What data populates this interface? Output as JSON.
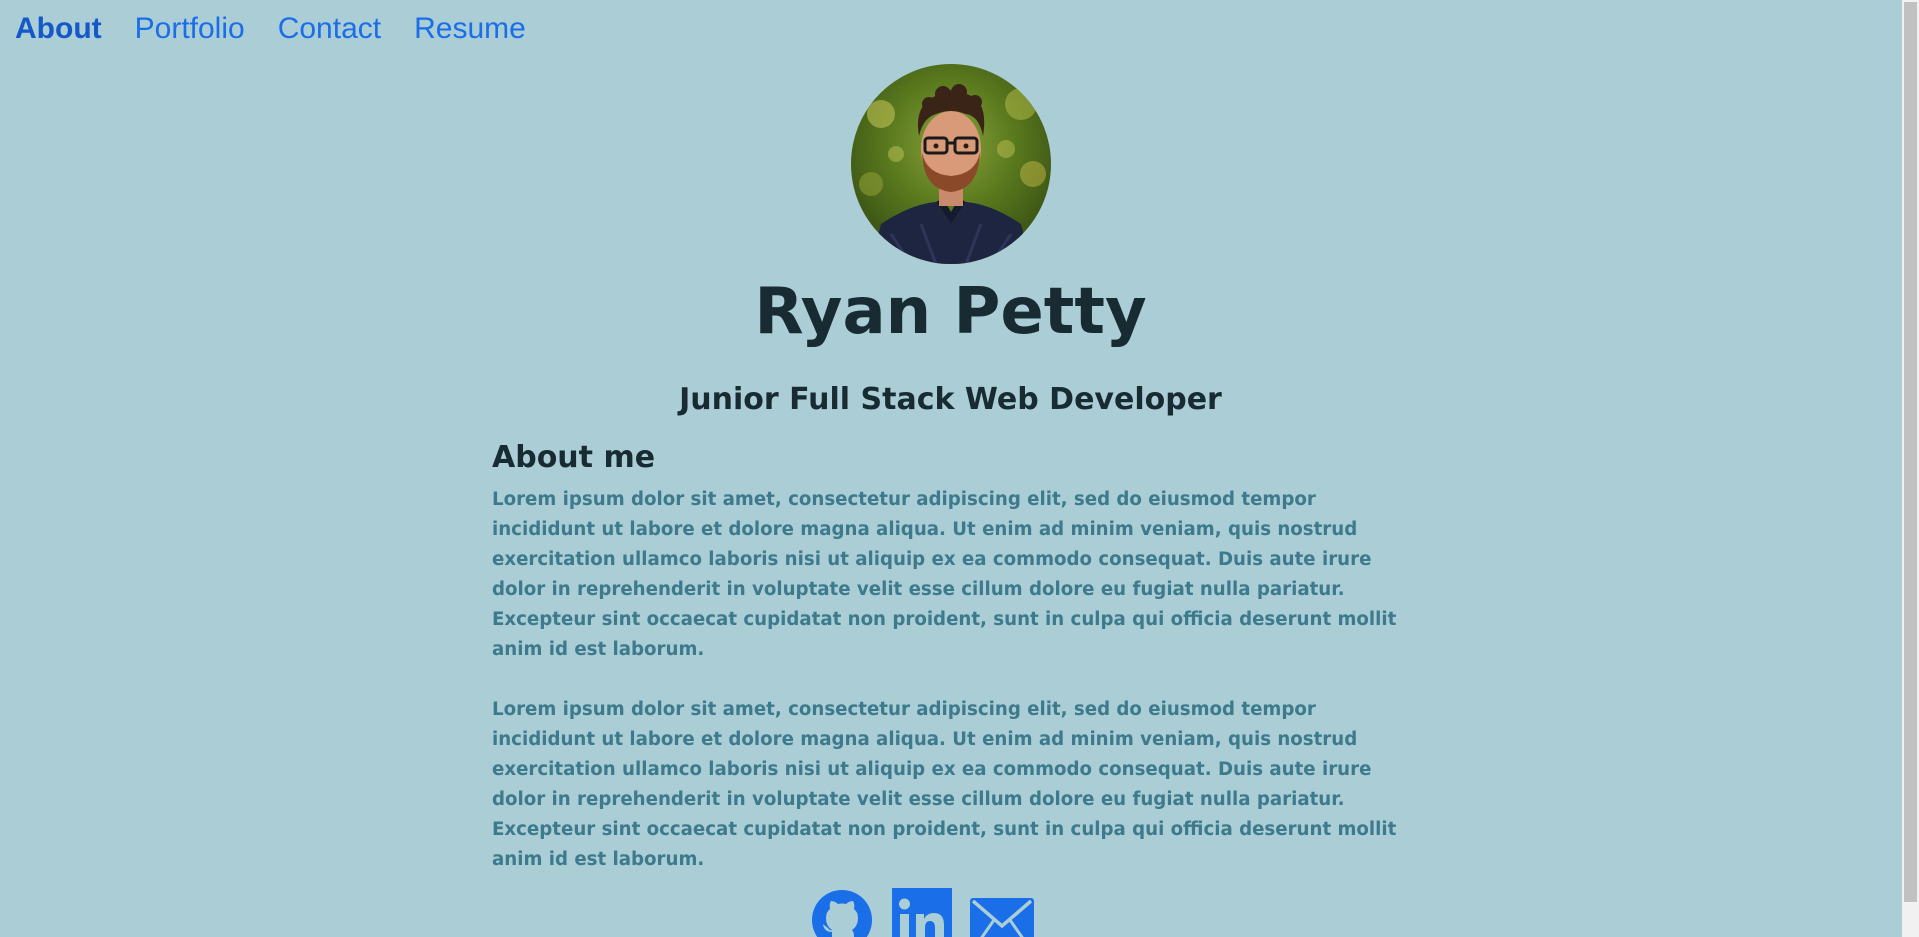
{
  "nav": {
    "items": [
      {
        "label": "About",
        "active": true
      },
      {
        "label": "Portfolio",
        "active": false
      },
      {
        "label": "Contact",
        "active": false
      },
      {
        "label": "Resume",
        "active": false
      }
    ]
  },
  "profile": {
    "name": "Ryan Petty",
    "title": "Junior Full Stack Web Developer"
  },
  "about": {
    "heading": "About me",
    "paragraphs": [
      "Lorem ipsum dolor sit amet, consectetur adipiscing elit, sed do eiusmod tempor incididunt ut labore et dolore magna aliqua. Ut enim ad minim veniam, quis nostrud exercitation ullamco laboris nisi ut aliquip ex ea commodo consequat. Duis aute irure dolor in reprehenderit in voluptate velit esse cillum dolore eu fugiat nulla pariatur. Excepteur sint occaecat cupidatat non proident, sunt in culpa qui officia deserunt mollit anim id est laborum.",
      "Lorem ipsum dolor sit amet, consectetur adipiscing elit, sed do eiusmod tempor incididunt ut labore et dolore magna aliqua. Ut enim ad minim veniam, quis nostrud exercitation ullamco laboris nisi ut aliquip ex ea commodo consequat. Duis aute irure dolor in reprehenderit in voluptate velit esse cillum dolore eu fugiat nulla pariatur. Excepteur sint occaecat cupidatat non proident, sunt in culpa qui officia deserunt mollit anim id est laborum."
    ]
  },
  "social": {
    "icons": [
      "github-icon",
      "linkedin-icon",
      "email-icon"
    ]
  },
  "colors": {
    "background": "#abcdd6",
    "link": "#1a6ee8",
    "heading": "#182b32",
    "body_text": "#3c7a8c"
  }
}
